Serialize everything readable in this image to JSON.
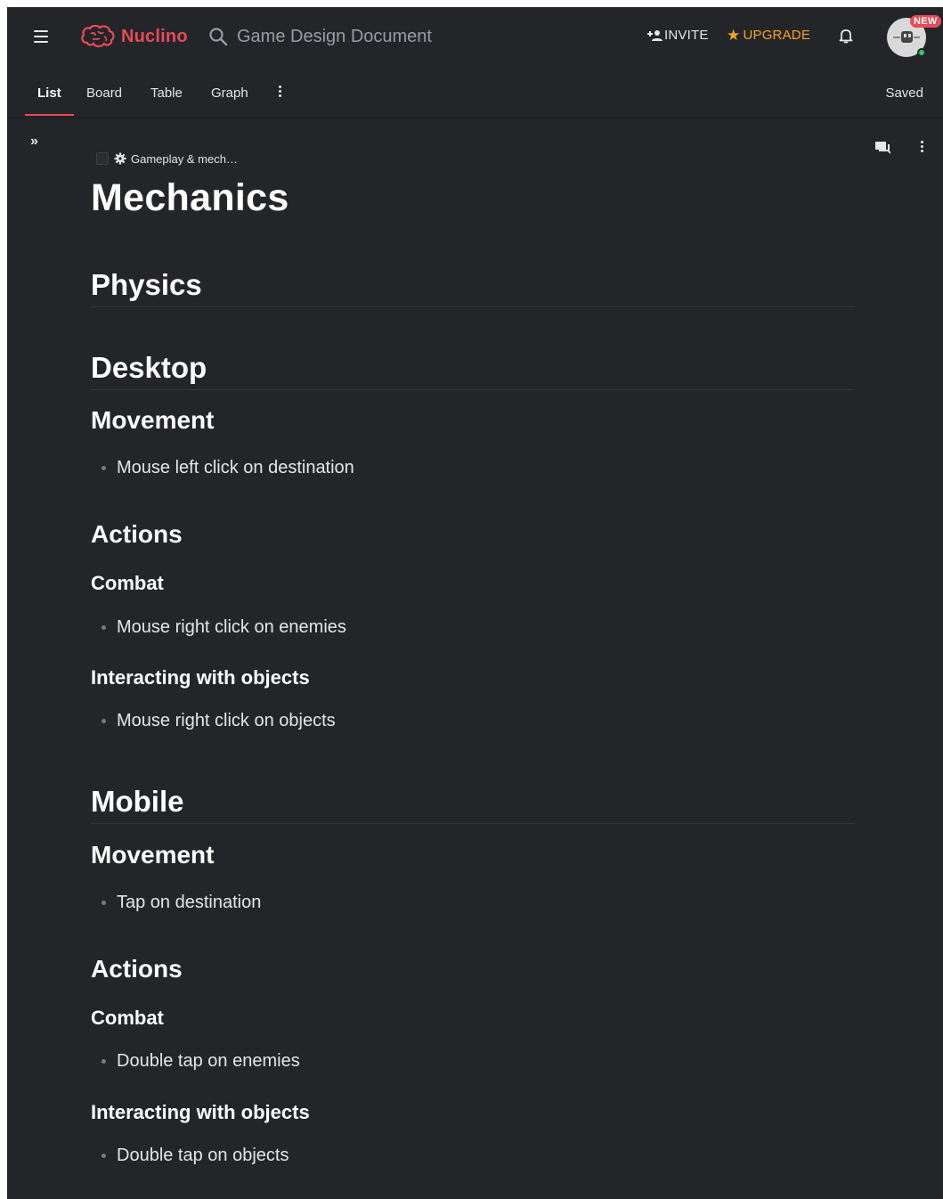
{
  "app": {
    "brand": "Nuclino",
    "brand_color": "#e94a57",
    "background": "#242529"
  },
  "topbar": {
    "search_text": "Game Design Document",
    "invite_label": "INVITE",
    "upgrade_label": "UPGRADE",
    "new_badge": "NEW",
    "icons": [
      "menu-icon",
      "brain-logo-icon",
      "search-icon",
      "add-person-icon",
      "star-icon",
      "bell-icon",
      "avatar"
    ]
  },
  "tabs": {
    "items": [
      {
        "label": "List",
        "active": true
      },
      {
        "label": "Board",
        "active": false
      },
      {
        "label": "Table",
        "active": false
      },
      {
        "label": "Graph",
        "active": false
      }
    ],
    "status": "Saved"
  },
  "document": {
    "breadcrumb": "Gameplay & mech…",
    "title": "Mechanics",
    "sections": {
      "physics": "Physics",
      "desktop": "Desktop",
      "desktop_movement": "Movement",
      "desktop_movement_item": "Mouse left click on destination",
      "desktop_actions": "Actions",
      "desktop_combat": "Combat",
      "desktop_combat_item": "Mouse right click on enemies",
      "desktop_interacting": "Interacting with objects",
      "desktop_interacting_item": "Mouse right click on objects",
      "mobile": "Mobile",
      "mobile_movement": "Movement",
      "mobile_movement_item": "Tap on destination",
      "mobile_actions": "Actions",
      "mobile_combat": "Combat",
      "mobile_combat_item": "Double tap on enemies",
      "mobile_interacting": "Interacting with objects",
      "mobile_interacting_item": "Double tap on objects"
    }
  }
}
